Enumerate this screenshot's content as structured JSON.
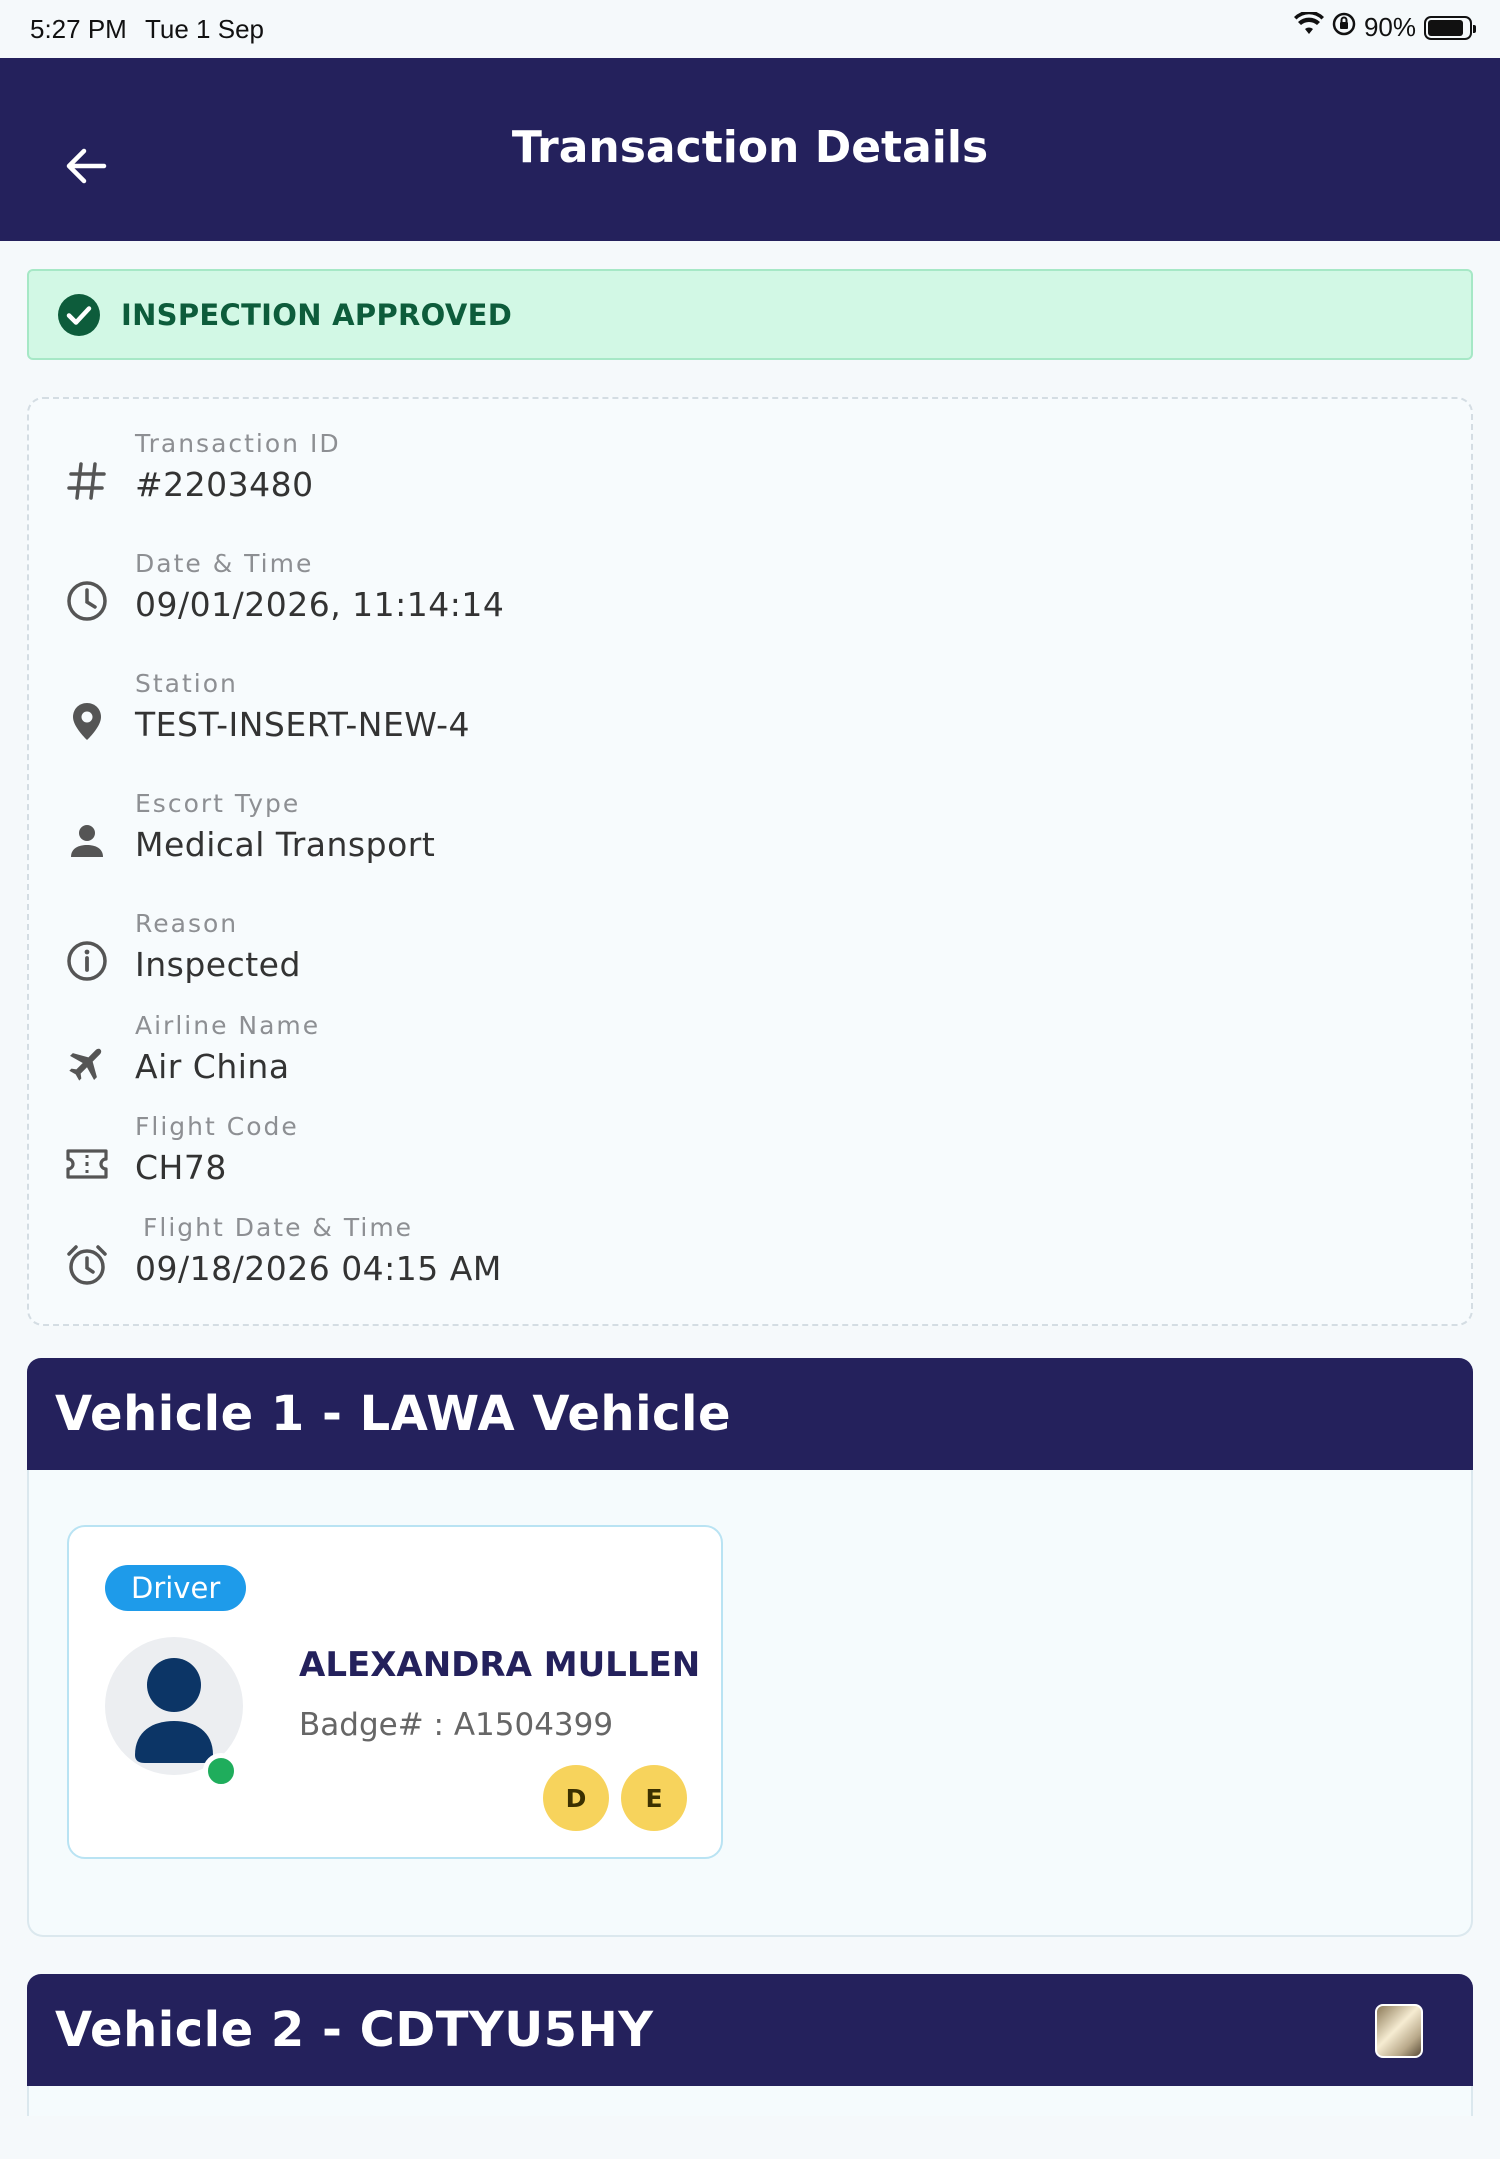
{
  "status_bar": {
    "time": "5:27 PM",
    "date": "Tue 1 Sep",
    "battery": "90%"
  },
  "header": {
    "title": "Transaction Details"
  },
  "status_banner": {
    "text": "INSPECTION APPROVED",
    "color": "#0d5c3b"
  },
  "details": [
    {
      "icon": "hash-icon",
      "label": "Transaction ID",
      "value": "#2203480"
    },
    {
      "icon": "clock-icon",
      "label": "Date & Time",
      "value": "09/01/2026, 11:14:14"
    },
    {
      "icon": "location-pin-icon",
      "label": "Station",
      "value": "TEST-INSERT-NEW-4"
    },
    {
      "icon": "person-icon",
      "label": "Escort Type",
      "value": "Medical Transport"
    },
    {
      "icon": "info-icon",
      "label": "Reason",
      "value": "Inspected"
    },
    {
      "icon": "airplane-icon",
      "label": "Airline Name",
      "value": "Air China"
    },
    {
      "icon": "ticket-icon",
      "label": "Flight Code",
      "value": "CH78"
    },
    {
      "icon": "alarm-clock-icon",
      "label": "Flight Date & Time",
      "value": "09/18/2026 04:15 AM"
    }
  ],
  "vehicles": [
    {
      "title": "Vehicle 1 - LAWA Vehicle",
      "people": [
        {
          "role": "Driver",
          "name": "ALEXANDRA MULLEN",
          "badge": "Badge# : A1504399",
          "endorsements": [
            "D",
            "E"
          ],
          "online": true
        }
      ]
    },
    {
      "title": "Vehicle 2 - CDTYU5HY"
    }
  ],
  "colors": {
    "header": "#24215c",
    "banner_bg": "#d2f8e5",
    "role_badge": "#1e9bea",
    "endorsement": "#f7d35c",
    "online": "#1fad5c"
  }
}
